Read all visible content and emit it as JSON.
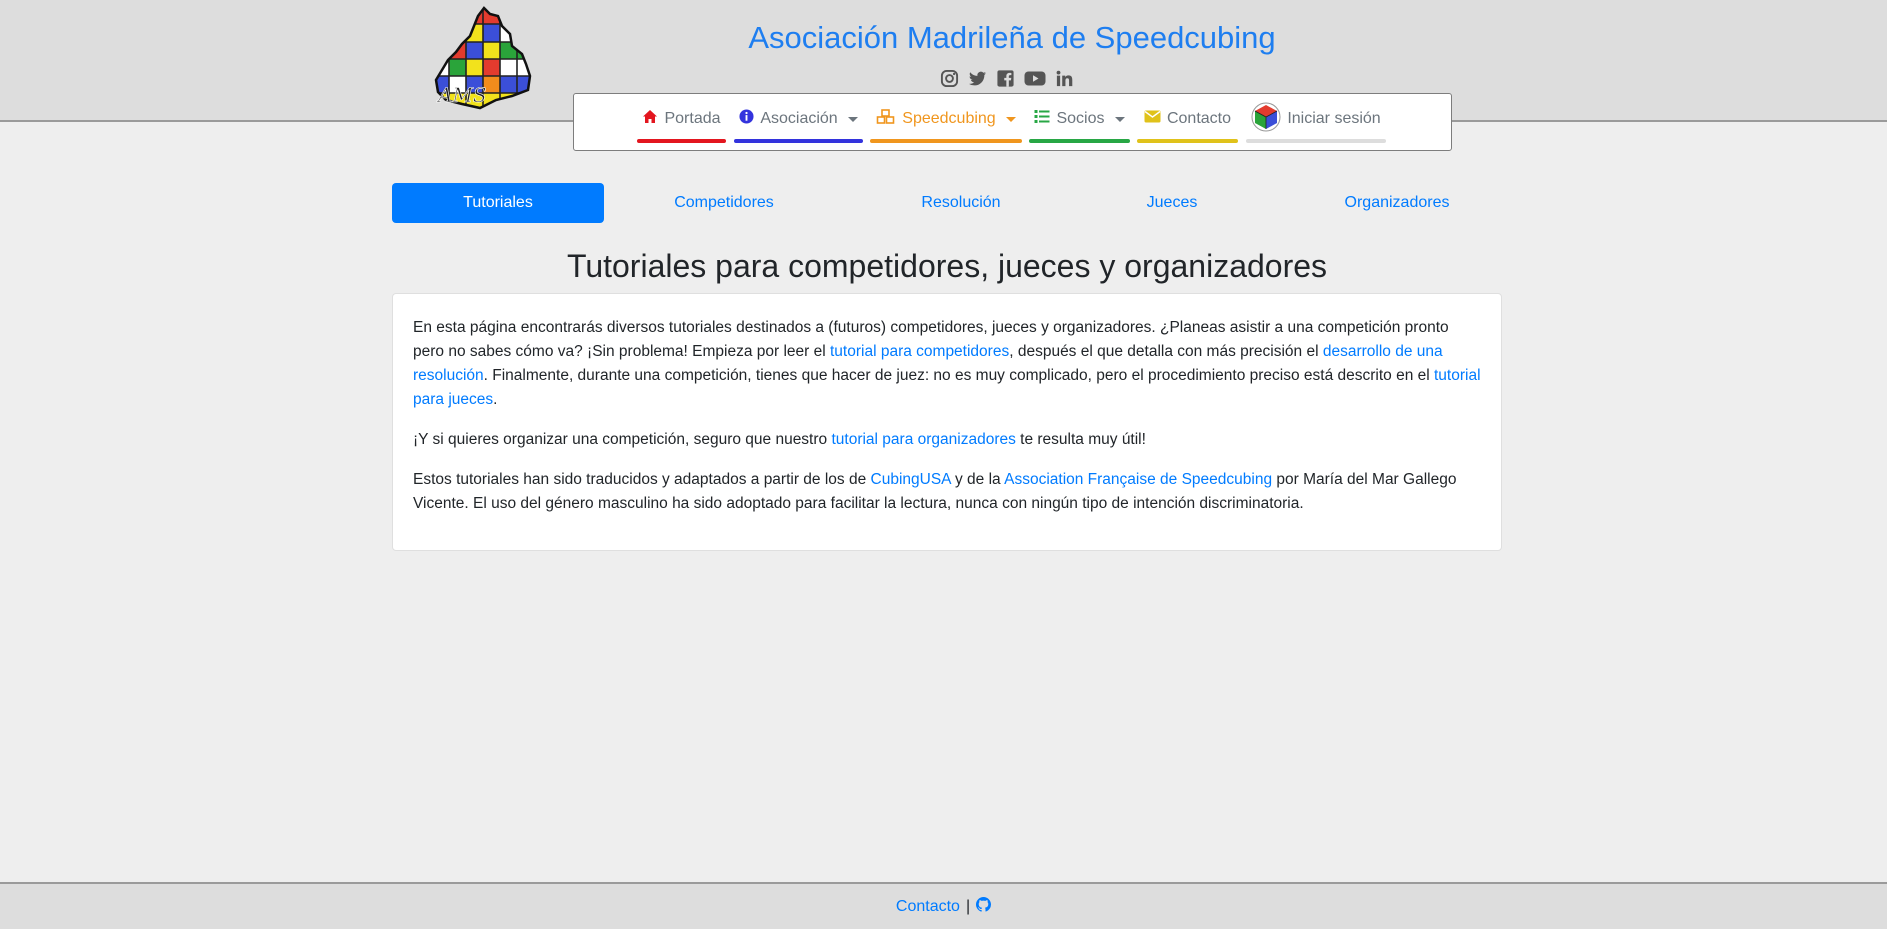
{
  "header": {
    "title": "Asociación Madrileña de Speedcubing",
    "logo_text": "AMS",
    "socials": [
      {
        "icon": "instagram-icon"
      },
      {
        "icon": "twitter-icon"
      },
      {
        "icon": "facebook-icon"
      },
      {
        "icon": "youtube-icon"
      },
      {
        "icon": "linkedin-icon"
      }
    ]
  },
  "nav": {
    "items": [
      {
        "label": "Portada",
        "icon": "home-icon",
        "color": "#e3161f"
      },
      {
        "label": "Asociación",
        "icon": "info-icon",
        "color": "#3333dd",
        "dropdown": true
      },
      {
        "label": "Speedcubing",
        "icon": "cubes-icon",
        "color": "#f0961e",
        "dropdown": true,
        "active": true
      },
      {
        "label": "Socios",
        "icon": "list-icon",
        "color": "#28a745",
        "dropdown": true
      },
      {
        "label": "Contacto",
        "icon": "envelope-icon",
        "color": "#e0c21a"
      },
      {
        "label": "Iniciar sesión",
        "icon": "wca-icon",
        "color": "#dddddd"
      }
    ]
  },
  "tabs": {
    "items": [
      "Tutoriales",
      "Competidores",
      "Resolución",
      "Jueces",
      "Organizadores"
    ],
    "active": "Tutoriales"
  },
  "main": {
    "heading": "Tutoriales para competidores, jueces y organizadores",
    "p1": {
      "t1": "En esta página encontrarás diversos tutoriales destinados a (futuros) competidores, jueces y organizadores. ¿Planeas asistir a una competición pronto pero no sabes cómo va? ¡Sin problema! Empieza por leer el ",
      "link1": "tutorial para competidores",
      "t2": ", después el que detalla con más precisión el ",
      "link2": "desarrollo de una resolución",
      "t3": ". Finalmente, durante una competición, tienes que hacer de juez: no es muy complicado, pero el procedimiento preciso está descrito en el ",
      "link3": "tutorial para jueces",
      "t4": "."
    },
    "p2": {
      "t1": "¡Y si quieres organizar una competición, seguro que nuestro ",
      "link1": "tutorial para organizadores",
      "t2": " te resulta muy útil!"
    },
    "p3": {
      "t1": "Estos tutoriales han sido traducidos y adaptados a partir de los de ",
      "link1": "CubingUSA",
      "t2": " y de la ",
      "link2": "Association Française de Speedcubing",
      "t3": " por María del Mar Gallego Vicente. El uso del género masculino ha sido adoptado para facilitar la lectura, nunca con ningún tipo de intención discriminatoria."
    }
  },
  "footer": {
    "contact": "Contacto",
    "separator": "|",
    "github_icon": "github-icon"
  },
  "colors": {
    "link": "#007bff",
    "title": "#1e7ef0",
    "header_bg": "#dddddd",
    "page_bg": "#eeeeee"
  }
}
